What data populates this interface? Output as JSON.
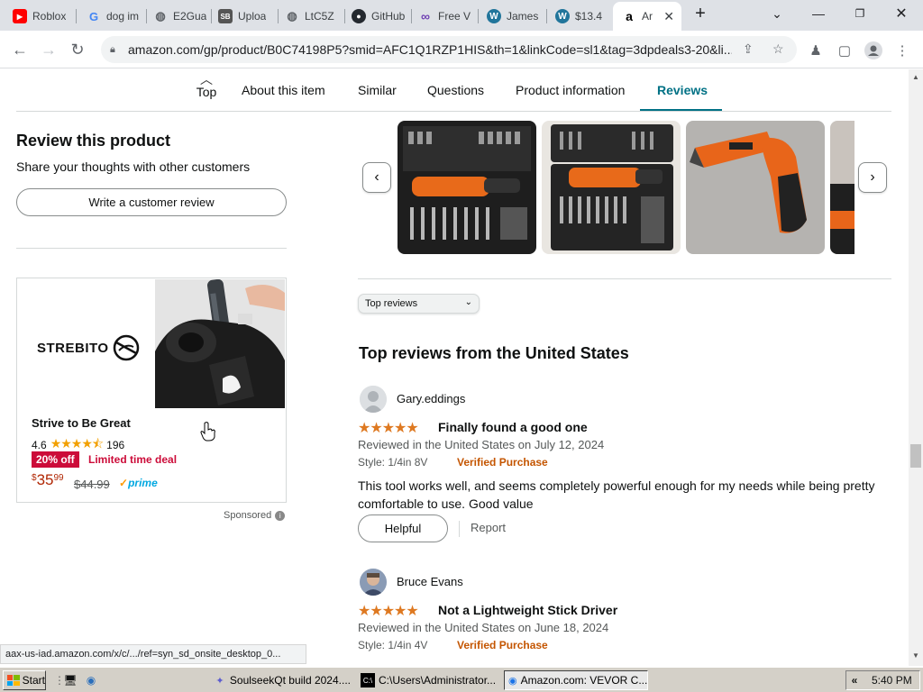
{
  "browser": {
    "tabs": [
      {
        "label": "Roblox",
        "icon": "youtube-icon",
        "color": "#ff0000"
      },
      {
        "label": "dog im",
        "icon": "google-icon",
        "color": "#4285f4"
      },
      {
        "label": "E2Gua",
        "icon": "globe-icon",
        "color": "#5f6368"
      },
      {
        "label": "Uploa",
        "icon": "sb-icon",
        "color": "#555555"
      },
      {
        "label": "LtC5Z",
        "icon": "globe-icon",
        "color": "#5f6368"
      },
      {
        "label": "GitHub",
        "icon": "github-icon",
        "color": "#24292f"
      },
      {
        "label": "Free V",
        "icon": "infinity-icon",
        "color": "#6f3fb3"
      },
      {
        "label": "James",
        "icon": "wordpress-icon",
        "color": "#21759b"
      },
      {
        "label": "$13.4",
        "icon": "wordpress-icon",
        "color": "#21759b"
      },
      {
        "label": "Ar",
        "icon": "amazon-icon",
        "color": "#000000",
        "active": true
      }
    ],
    "new_tab": "+",
    "url": "amazon.com/gp/product/B0C74198P5?smid=AFC1Q1RZP1HIS&th=1&linkCode=sl1&tag=3dpdeals3-20&li...",
    "status_url": "aax-us-iad.amazon.com/x/c/.../ref=syn_sd_onsite_desktop_0..."
  },
  "page_nav": {
    "top_label": "Top",
    "tabs": [
      "About this item",
      "Similar",
      "Questions",
      "Product information",
      "Reviews"
    ],
    "active_tab": "Reviews"
  },
  "review_product": {
    "heading": "Review this product",
    "subtext": "Share your thoughts with other customers",
    "button": "Write a customer review"
  },
  "ad": {
    "logo_text": "STREBITO",
    "brand_line": "Strive to Be Great",
    "rating": "4.6",
    "rating_stars": 4.5,
    "review_count": "196",
    "deal_badge": "20% off",
    "deal_text": "Limited time deal",
    "price_symbol": "$",
    "price_whole": "35",
    "price_fraction": "99",
    "list_price": "$44.99",
    "prime_label": "prime",
    "sponsored": "Sponsored"
  },
  "reviews": {
    "sort_label": "Top reviews",
    "heading": "Top reviews from the United States",
    "items": [
      {
        "name": "Gary.eddings",
        "stars": 5,
        "title": "Finally found a good one",
        "date": "Reviewed in the United States on July 12, 2024",
        "style": "Style: 1/4in 8V",
        "verified": "Verified Purchase",
        "body": "This tool works well, and seems completely powerful enough for my needs while being pretty comfortable to use. Good value",
        "helpful": "Helpful",
        "report": "Report"
      },
      {
        "name": "Bruce Evans",
        "stars": 5,
        "title": "Not a Lightweight Stick Driver",
        "date": "Reviewed in the United States on June 18, 2024",
        "style": "Style: 1/4in 4V",
        "verified": "Verified Purchase"
      }
    ]
  },
  "taskbar": {
    "start": "Start",
    "tasks": [
      {
        "label": "SoulseekQt build 2024....",
        "icon": "soulseek-icon"
      },
      {
        "label": "C:\\Users\\Administrator...",
        "icon": "console-icon"
      },
      {
        "label": "Amazon.com: VEVOR C...",
        "icon": "chrome-icon",
        "active": true
      }
    ],
    "tray_chevron": "«",
    "clock": "5:40 PM"
  },
  "colors": {
    "accent_teal": "#007185",
    "star_orange": "#de7921",
    "verified_orange": "#c45500",
    "deal_red": "#cc0c39",
    "price_red": "#b12704"
  }
}
